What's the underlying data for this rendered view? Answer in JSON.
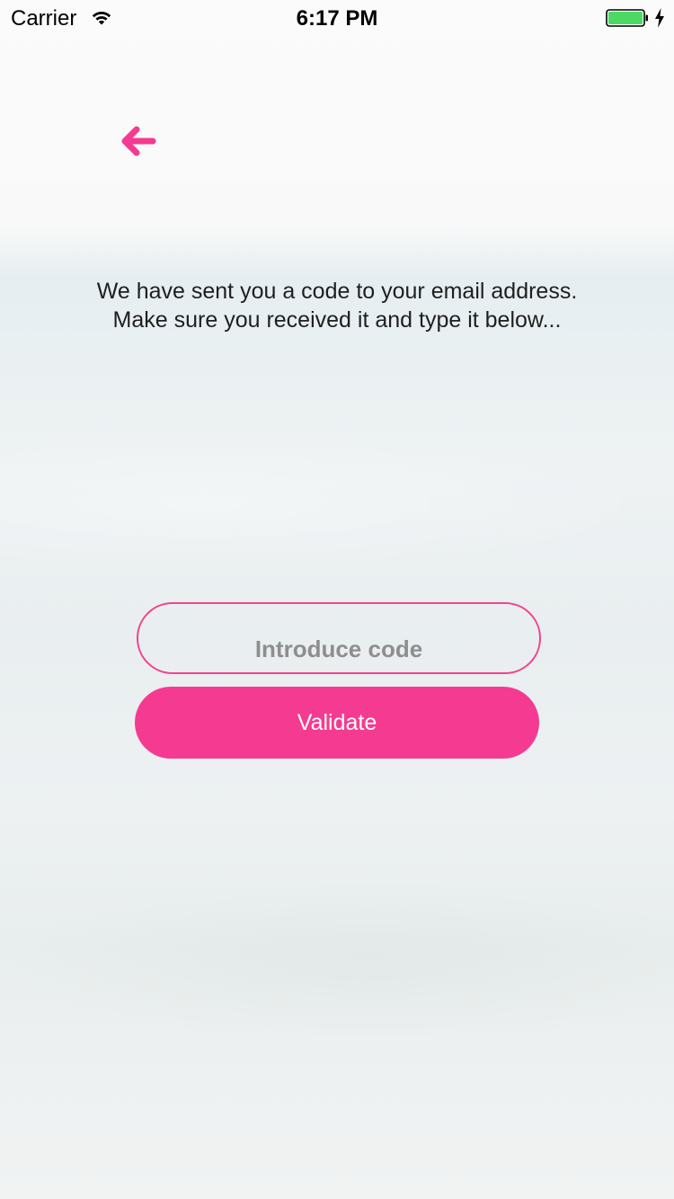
{
  "status_bar": {
    "carrier": "Carrier",
    "time": "6:17 PM",
    "wifi_icon": "wifi-icon",
    "battery_icon": "battery-icon",
    "charging_icon": "charging-bolt-icon",
    "battery_color": "#4cd964"
  },
  "navigation": {
    "back_icon": "back-arrow-icon",
    "accent_color": "#f53b91"
  },
  "message": {
    "text": "We have sent you a code to your email address. Make sure you received it and type it below..."
  },
  "code_input": {
    "placeholder": "Introduce code",
    "value": ""
  },
  "validate_button": {
    "label": "Validate",
    "color": "#f53b91"
  }
}
